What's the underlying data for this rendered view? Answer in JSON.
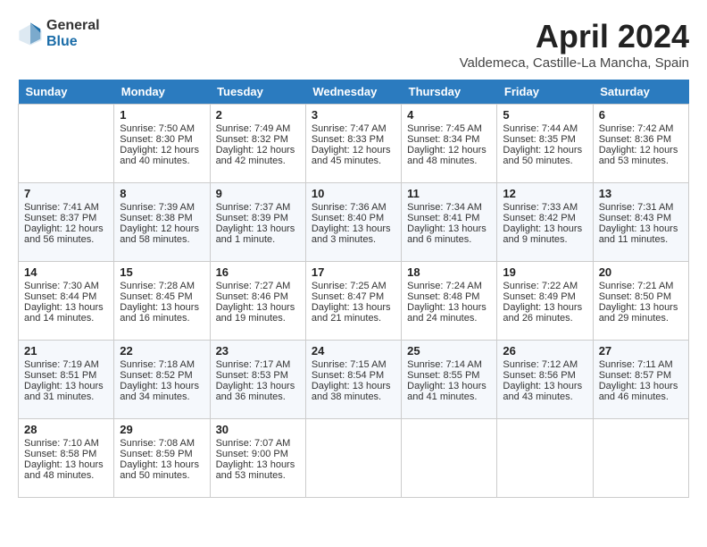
{
  "header": {
    "logo_general": "General",
    "logo_blue": "Blue",
    "title": "April 2024",
    "location": "Valdemeca, Castille-La Mancha, Spain"
  },
  "days_of_week": [
    "Sunday",
    "Monday",
    "Tuesday",
    "Wednesday",
    "Thursday",
    "Friday",
    "Saturday"
  ],
  "weeks": [
    [
      {
        "day": "",
        "empty": true
      },
      {
        "day": "1",
        "sunrise": "Sunrise: 7:50 AM",
        "sunset": "Sunset: 8:30 PM",
        "daylight": "Daylight: 12 hours and 40 minutes."
      },
      {
        "day": "2",
        "sunrise": "Sunrise: 7:49 AM",
        "sunset": "Sunset: 8:32 PM",
        "daylight": "Daylight: 12 hours and 42 minutes."
      },
      {
        "day": "3",
        "sunrise": "Sunrise: 7:47 AM",
        "sunset": "Sunset: 8:33 PM",
        "daylight": "Daylight: 12 hours and 45 minutes."
      },
      {
        "day": "4",
        "sunrise": "Sunrise: 7:45 AM",
        "sunset": "Sunset: 8:34 PM",
        "daylight": "Daylight: 12 hours and 48 minutes."
      },
      {
        "day": "5",
        "sunrise": "Sunrise: 7:44 AM",
        "sunset": "Sunset: 8:35 PM",
        "daylight": "Daylight: 12 hours and 50 minutes."
      },
      {
        "day": "6",
        "sunrise": "Sunrise: 7:42 AM",
        "sunset": "Sunset: 8:36 PM",
        "daylight": "Daylight: 12 hours and 53 minutes."
      }
    ],
    [
      {
        "day": "7",
        "sunrise": "Sunrise: 7:41 AM",
        "sunset": "Sunset: 8:37 PM",
        "daylight": "Daylight: 12 hours and 56 minutes."
      },
      {
        "day": "8",
        "sunrise": "Sunrise: 7:39 AM",
        "sunset": "Sunset: 8:38 PM",
        "daylight": "Daylight: 12 hours and 58 minutes."
      },
      {
        "day": "9",
        "sunrise": "Sunrise: 7:37 AM",
        "sunset": "Sunset: 8:39 PM",
        "daylight": "Daylight: 13 hours and 1 minute."
      },
      {
        "day": "10",
        "sunrise": "Sunrise: 7:36 AM",
        "sunset": "Sunset: 8:40 PM",
        "daylight": "Daylight: 13 hours and 3 minutes."
      },
      {
        "day": "11",
        "sunrise": "Sunrise: 7:34 AM",
        "sunset": "Sunset: 8:41 PM",
        "daylight": "Daylight: 13 hours and 6 minutes."
      },
      {
        "day": "12",
        "sunrise": "Sunrise: 7:33 AM",
        "sunset": "Sunset: 8:42 PM",
        "daylight": "Daylight: 13 hours and 9 minutes."
      },
      {
        "day": "13",
        "sunrise": "Sunrise: 7:31 AM",
        "sunset": "Sunset: 8:43 PM",
        "daylight": "Daylight: 13 hours and 11 minutes."
      }
    ],
    [
      {
        "day": "14",
        "sunrise": "Sunrise: 7:30 AM",
        "sunset": "Sunset: 8:44 PM",
        "daylight": "Daylight: 13 hours and 14 minutes."
      },
      {
        "day": "15",
        "sunrise": "Sunrise: 7:28 AM",
        "sunset": "Sunset: 8:45 PM",
        "daylight": "Daylight: 13 hours and 16 minutes."
      },
      {
        "day": "16",
        "sunrise": "Sunrise: 7:27 AM",
        "sunset": "Sunset: 8:46 PM",
        "daylight": "Daylight: 13 hours and 19 minutes."
      },
      {
        "day": "17",
        "sunrise": "Sunrise: 7:25 AM",
        "sunset": "Sunset: 8:47 PM",
        "daylight": "Daylight: 13 hours and 21 minutes."
      },
      {
        "day": "18",
        "sunrise": "Sunrise: 7:24 AM",
        "sunset": "Sunset: 8:48 PM",
        "daylight": "Daylight: 13 hours and 24 minutes."
      },
      {
        "day": "19",
        "sunrise": "Sunrise: 7:22 AM",
        "sunset": "Sunset: 8:49 PM",
        "daylight": "Daylight: 13 hours and 26 minutes."
      },
      {
        "day": "20",
        "sunrise": "Sunrise: 7:21 AM",
        "sunset": "Sunset: 8:50 PM",
        "daylight": "Daylight: 13 hours and 29 minutes."
      }
    ],
    [
      {
        "day": "21",
        "sunrise": "Sunrise: 7:19 AM",
        "sunset": "Sunset: 8:51 PM",
        "daylight": "Daylight: 13 hours and 31 minutes."
      },
      {
        "day": "22",
        "sunrise": "Sunrise: 7:18 AM",
        "sunset": "Sunset: 8:52 PM",
        "daylight": "Daylight: 13 hours and 34 minutes."
      },
      {
        "day": "23",
        "sunrise": "Sunrise: 7:17 AM",
        "sunset": "Sunset: 8:53 PM",
        "daylight": "Daylight: 13 hours and 36 minutes."
      },
      {
        "day": "24",
        "sunrise": "Sunrise: 7:15 AM",
        "sunset": "Sunset: 8:54 PM",
        "daylight": "Daylight: 13 hours and 38 minutes."
      },
      {
        "day": "25",
        "sunrise": "Sunrise: 7:14 AM",
        "sunset": "Sunset: 8:55 PM",
        "daylight": "Daylight: 13 hours and 41 minutes."
      },
      {
        "day": "26",
        "sunrise": "Sunrise: 7:12 AM",
        "sunset": "Sunset: 8:56 PM",
        "daylight": "Daylight: 13 hours and 43 minutes."
      },
      {
        "day": "27",
        "sunrise": "Sunrise: 7:11 AM",
        "sunset": "Sunset: 8:57 PM",
        "daylight": "Daylight: 13 hours and 46 minutes."
      }
    ],
    [
      {
        "day": "28",
        "sunrise": "Sunrise: 7:10 AM",
        "sunset": "Sunset: 8:58 PM",
        "daylight": "Daylight: 13 hours and 48 minutes."
      },
      {
        "day": "29",
        "sunrise": "Sunrise: 7:08 AM",
        "sunset": "Sunset: 8:59 PM",
        "daylight": "Daylight: 13 hours and 50 minutes."
      },
      {
        "day": "30",
        "sunrise": "Sunrise: 7:07 AM",
        "sunset": "Sunset: 9:00 PM",
        "daylight": "Daylight: 13 hours and 53 minutes."
      },
      {
        "day": "",
        "empty": true
      },
      {
        "day": "",
        "empty": true
      },
      {
        "day": "",
        "empty": true
      },
      {
        "day": "",
        "empty": true
      }
    ]
  ]
}
